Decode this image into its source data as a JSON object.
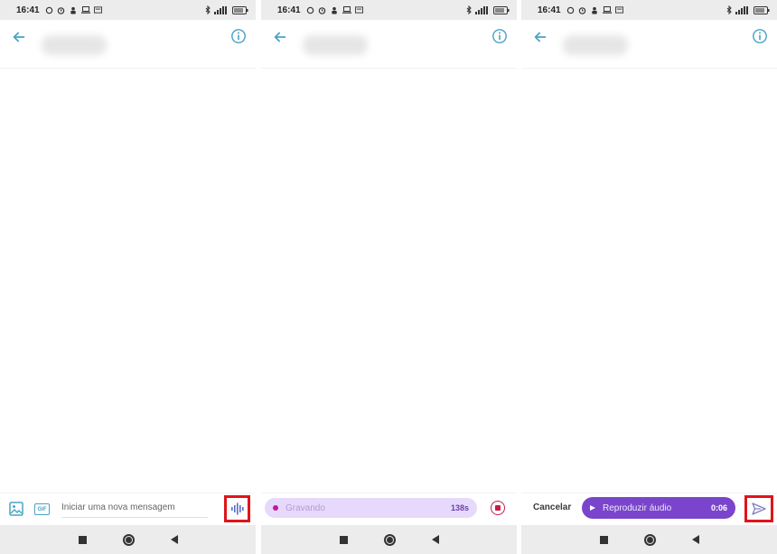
{
  "status": {
    "time": "16:41"
  },
  "screens": [
    {
      "composer": {
        "placeholder": "Iniciar uma nova mensagem",
        "gif_label": "GIF"
      }
    },
    {
      "recording": {
        "label": "Gravando",
        "counter": "138s"
      }
    },
    {
      "playback": {
        "cancel_label": "Cancelar",
        "play_label": "Reproduzir áudio",
        "duration": "0:06"
      }
    }
  ],
  "icons": {
    "back": "arrow-left-icon",
    "info": "info-icon",
    "image": "image-icon",
    "voice": "voice-wave-icon",
    "stop": "stop-icon",
    "play": "play-icon",
    "send": "send-icon"
  },
  "colors": {
    "accent": "#4aa3c6",
    "highlight": "#e0141a",
    "recording_pill": "#e7d9fb",
    "recording_text": "#6b3fb0",
    "playback_pill": "#7a45cc",
    "stop": "#c71e4a"
  }
}
